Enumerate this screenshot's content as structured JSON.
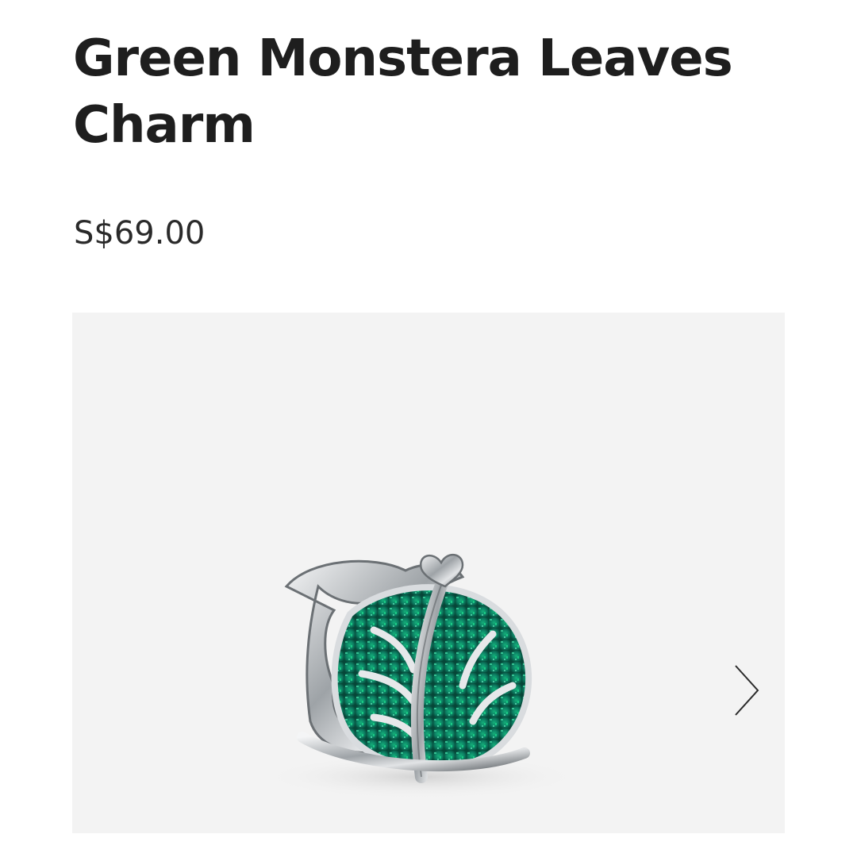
{
  "product": {
    "title": "Green Monstera Leaves Charm",
    "price": "S$69.00"
  },
  "gallery": {
    "background_color": "#f3f3f3",
    "image": {
      "name": "product-photo",
      "description_icon": "monstera-charm"
    },
    "next_icon": "chevron-right-icon"
  },
  "colors": {
    "text": "#1e1e1e",
    "enamel_green": "#0f7a5c",
    "silver": "#c9cdd0"
  }
}
